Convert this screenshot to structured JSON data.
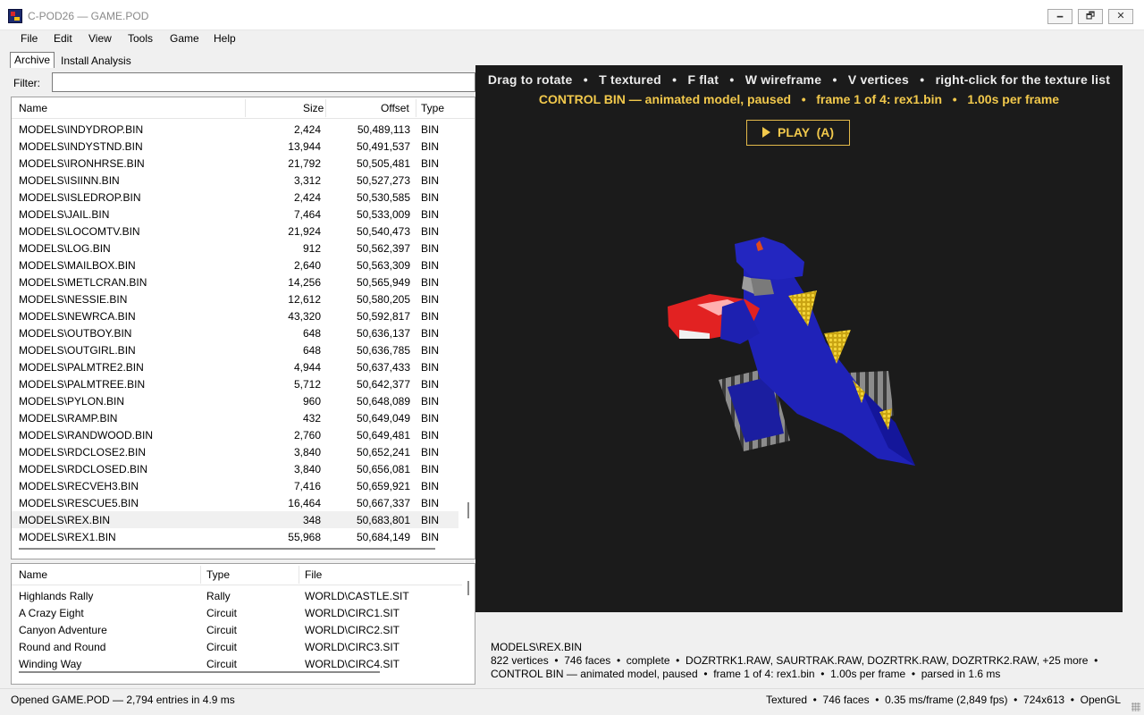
{
  "window": {
    "title": "C-POD26 — GAME.POD",
    "minimize_glyph": "🗕",
    "maximize_glyph": "🗗",
    "close_glyph": "✕",
    "icon": "app-icon"
  },
  "menu": [
    "File",
    "Edit",
    "View",
    "Tools",
    "Game",
    "Help"
  ],
  "tabs": [
    "Archive",
    "Install Analysis"
  ],
  "filter": {
    "label": "Filter:",
    "value": ""
  },
  "file_list": {
    "columns": [
      "Name",
      "Size",
      "Offset",
      "Type"
    ],
    "selected_index": 23,
    "rows": [
      [
        "MODELS\\INDYDROP.BIN",
        "2,424",
        "50,489,113",
        "BIN"
      ],
      [
        "MODELS\\INDYSTND.BIN",
        "13,944",
        "50,491,537",
        "BIN"
      ],
      [
        "MODELS\\IRONHRSE.BIN",
        "21,792",
        "50,505,481",
        "BIN"
      ],
      [
        "MODELS\\ISIINN.BIN",
        "3,312",
        "50,527,273",
        "BIN"
      ],
      [
        "MODELS\\ISLEDROP.BIN",
        "2,424",
        "50,530,585",
        "BIN"
      ],
      [
        "MODELS\\JAIL.BIN",
        "7,464",
        "50,533,009",
        "BIN"
      ],
      [
        "MODELS\\LOCOMTV.BIN",
        "21,924",
        "50,540,473",
        "BIN"
      ],
      [
        "MODELS\\LOG.BIN",
        "912",
        "50,562,397",
        "BIN"
      ],
      [
        "MODELS\\MAILBOX.BIN",
        "2,640",
        "50,563,309",
        "BIN"
      ],
      [
        "MODELS\\METLCRAN.BIN",
        "14,256",
        "50,565,949",
        "BIN"
      ],
      [
        "MODELS\\NESSIE.BIN",
        "12,612",
        "50,580,205",
        "BIN"
      ],
      [
        "MODELS\\NEWRCA.BIN",
        "43,320",
        "50,592,817",
        "BIN"
      ],
      [
        "MODELS\\OUTBOY.BIN",
        "648",
        "50,636,137",
        "BIN"
      ],
      [
        "MODELS\\OUTGIRL.BIN",
        "648",
        "50,636,785",
        "BIN"
      ],
      [
        "MODELS\\PALMTRE2.BIN",
        "4,944",
        "50,637,433",
        "BIN"
      ],
      [
        "MODELS\\PALMTREE.BIN",
        "5,712",
        "50,642,377",
        "BIN"
      ],
      [
        "MODELS\\PYLON.BIN",
        "960",
        "50,648,089",
        "BIN"
      ],
      [
        "MODELS\\RAMP.BIN",
        "432",
        "50,649,049",
        "BIN"
      ],
      [
        "MODELS\\RANDWOOD.BIN",
        "2,760",
        "50,649,481",
        "BIN"
      ],
      [
        "MODELS\\RDCLOSE2.BIN",
        "3,840",
        "50,652,241",
        "BIN"
      ],
      [
        "MODELS\\RDCLOSED.BIN",
        "3,840",
        "50,656,081",
        "BIN"
      ],
      [
        "MODELS\\RECVEH3.BIN",
        "7,416",
        "50,659,921",
        "BIN"
      ],
      [
        "MODELS\\RESCUE5.BIN",
        "16,464",
        "50,667,337",
        "BIN"
      ],
      [
        "MODELS\\REX.BIN",
        "348",
        "50,683,801",
        "BIN"
      ],
      [
        "MODELS\\REX1.BIN",
        "55,968",
        "50,684,149",
        "BIN"
      ]
    ]
  },
  "track_list": {
    "columns": [
      "Name",
      "Type",
      "File"
    ],
    "rows": [
      [
        "Highlands Rally",
        "Rally",
        "WORLD\\CASTLE.SIT"
      ],
      [
        "A Crazy Eight",
        "Circuit",
        "WORLD\\CIRC1.SIT"
      ],
      [
        "Canyon Adventure",
        "Circuit",
        "WORLD\\CIRC2.SIT"
      ],
      [
        "Round and Round",
        "Circuit",
        "WORLD\\CIRC3.SIT"
      ],
      [
        "Winding Way",
        "Circuit",
        "WORLD\\CIRC4.SIT"
      ]
    ]
  },
  "viewer": {
    "hint": "Drag to rotate   •   T textured   •   F flat   •   W wireframe   •   V vertices   •   right-click for the texture list",
    "status": "CONTROL BIN — animated model, paused   •   frame 1 of 4: rex1.bin   •   1.00s per frame",
    "play_label": "PLAY  (A)",
    "background": "#1b1b1b",
    "accent": "#f2c94c"
  },
  "info": {
    "file": "MODELS\\REX.BIN",
    "details": "822 vertices  •  746 faces  •  complete  •  DOZRTRK1.RAW, SAURTRAK.RAW, DOZRTRK.RAW, DOZRTRK2.RAW, +25 more  •  CONTROL BIN — animated model, paused  •  frame 1 of 4: rex1.bin  •  1.00s per frame  •  parsed in 1.6 ms"
  },
  "statusbar": {
    "left": "Opened GAME.POD — 2,794 entries in 4.9 ms",
    "right": "Textured  •  746 faces  •  0.35 ms/frame (2,849 fps)  •  724x613  •  OpenGL"
  }
}
